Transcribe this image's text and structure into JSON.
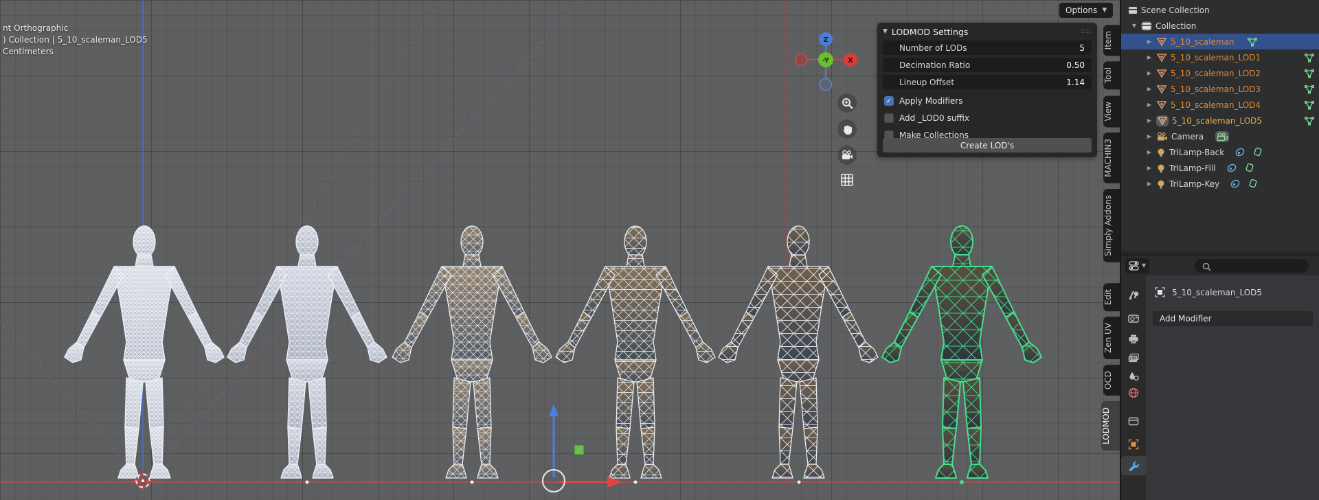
{
  "header": {
    "options_label": "Options"
  },
  "viewport_overlay": {
    "line1": "nt Orthographic",
    "line2": ") Collection | 5_10_scaleman_LOD5",
    "line3": "Centimeters"
  },
  "gizmo": {
    "z_label": "Z",
    "y_label": "-Y",
    "x_label": "X"
  },
  "lodmod_panel": {
    "title": "LODMOD Settings",
    "fields": [
      {
        "label": "Number of LODs",
        "value": "5"
      },
      {
        "label": "Decimation Ratio",
        "value": "0.50"
      },
      {
        "label": "Lineup Offset",
        "value": "1.14"
      }
    ],
    "checkboxes": [
      {
        "label": "Apply Modifiers",
        "checked": true
      },
      {
        "label": "Add _LOD0 suffix",
        "checked": false
      },
      {
        "label": "Make Collections",
        "checked": false
      }
    ],
    "create_button": "Create LOD's"
  },
  "sidebar_tabs": [
    {
      "label": "Item",
      "active": false
    },
    {
      "label": "Tool",
      "active": false
    },
    {
      "label": "View",
      "active": false
    },
    {
      "label": "MACHIN3",
      "active": false
    },
    {
      "label": "Simply Addons",
      "active": false
    },
    {
      "label": "Edit",
      "active": false
    },
    {
      "label": "Zen UV",
      "active": false
    },
    {
      "label": "OCD",
      "active": false
    },
    {
      "label": "LODMOD",
      "active": true
    }
  ],
  "outliner": {
    "rows": [
      {
        "label": "Scene Collection",
        "type": "scene-collection"
      },
      {
        "label": "Collection",
        "type": "collection",
        "expanded": true
      },
      {
        "label": "5_10_scaleman",
        "type": "mesh",
        "selected": true
      },
      {
        "label": "5_10_scaleman_LOD1",
        "type": "mesh"
      },
      {
        "label": "5_10_scaleman_LOD2",
        "type": "mesh"
      },
      {
        "label": "5_10_scaleman_LOD3",
        "type": "mesh"
      },
      {
        "label": "5_10_scaleman_LOD4",
        "type": "mesh"
      },
      {
        "label": "5_10_scaleman_LOD5",
        "type": "mesh",
        "active": true
      },
      {
        "label": "Camera",
        "type": "camera"
      },
      {
        "label": "TriLamp-Back",
        "type": "light"
      },
      {
        "label": "TriLamp-Fill",
        "type": "light"
      },
      {
        "label": "TriLamp-Key",
        "type": "light"
      }
    ]
  },
  "properties": {
    "search_placeholder": "",
    "object_name": "5_10_scaleman_LOD5",
    "add_modifier_label": "Add Modifier",
    "tab_icons": [
      "tool",
      "render",
      "output",
      "view-layer",
      "scene",
      "world",
      "object-data",
      "object",
      "modifiers"
    ]
  },
  "colors": {
    "select_blue": "#33518c",
    "object_orange": "#e08a33",
    "active_gold": "#f0ad42",
    "selected_wire_green": "#45e08d",
    "axis_red": "#c0504f",
    "axis_blue": "#4a7fd6",
    "gizmo_green": "#6abe30"
  }
}
